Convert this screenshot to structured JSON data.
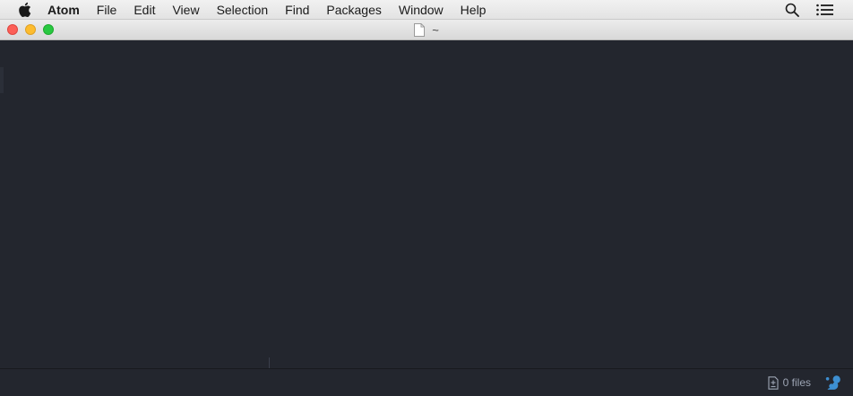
{
  "menubar": {
    "apple_icon": "apple-logo-icon",
    "items": [
      {
        "label": "Atom",
        "bold": true
      },
      {
        "label": "File"
      },
      {
        "label": "Edit"
      },
      {
        "label": "View"
      },
      {
        "label": "Selection"
      },
      {
        "label": "Find"
      },
      {
        "label": "Packages"
      },
      {
        "label": "Window"
      },
      {
        "label": "Help"
      }
    ],
    "right_icons": [
      "spotlight-search-icon",
      "notification-center-icon"
    ]
  },
  "window": {
    "title": "~",
    "title_icon": "document-icon",
    "traffic_lights": {
      "close": "#fc5f57",
      "minimize": "#fdbc2e",
      "maximize": "#28c840"
    }
  },
  "editor": {
    "background": "#23262e"
  },
  "statusbar": {
    "files_icon": "git-file-icon",
    "files_label": "0 files",
    "update_icon": "squirrel-update-icon",
    "update_icon_color": "#3d8fd1"
  }
}
